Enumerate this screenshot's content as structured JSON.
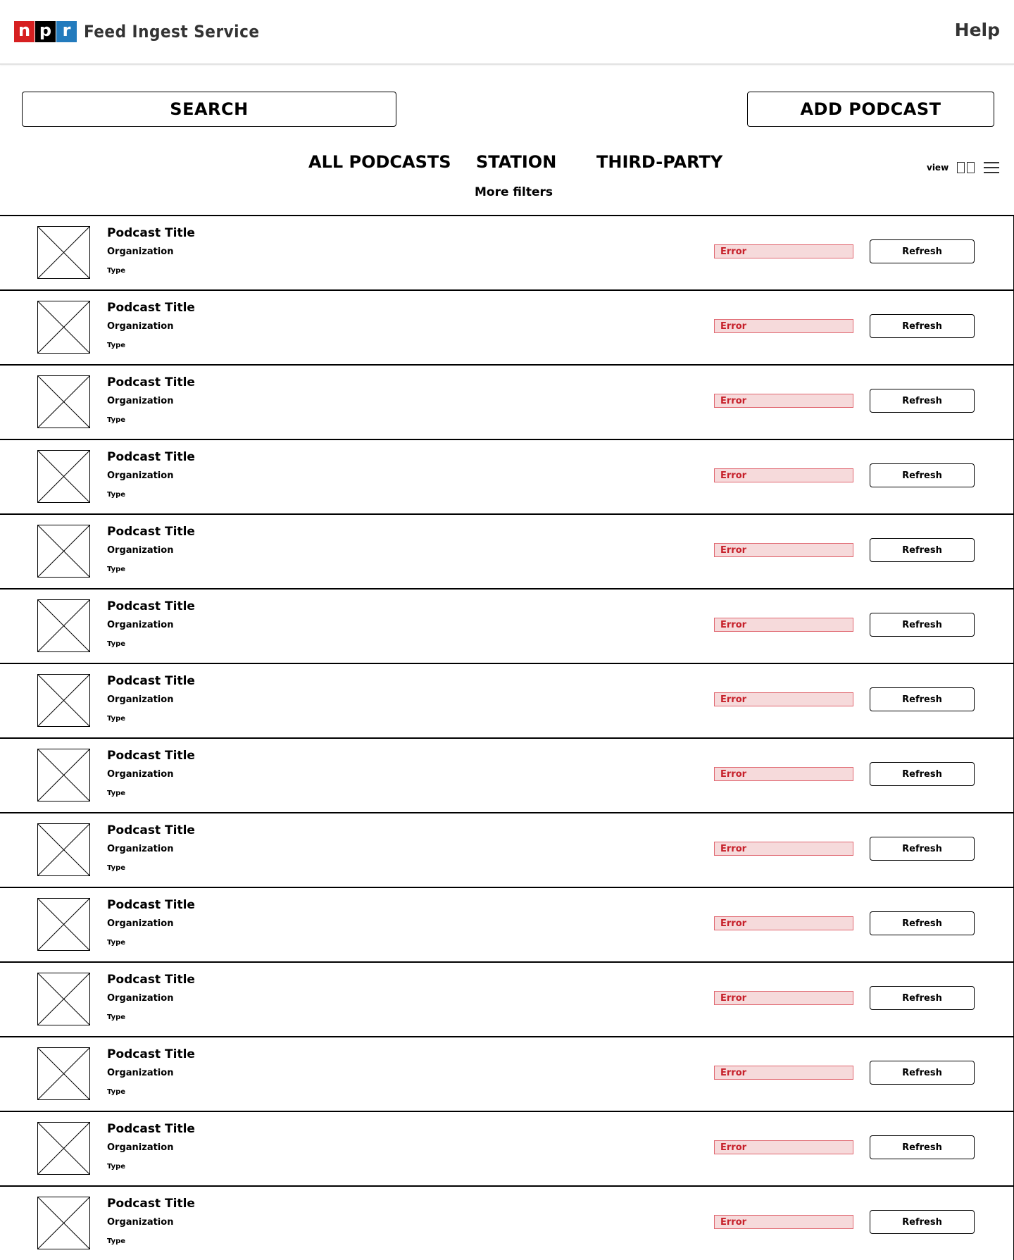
{
  "header": {
    "logo_letters": [
      "n",
      "p",
      "r"
    ],
    "logo_colors": [
      "#d62021",
      "#000000",
      "#237bbd"
    ],
    "title": "Feed Ingest Service",
    "help_label": "Help"
  },
  "actions": {
    "search_label": "Search",
    "add_label": "Add Podcast"
  },
  "tabs": [
    {
      "label": "All Podcasts"
    },
    {
      "label": "Station"
    },
    {
      "label": "Third-Party"
    }
  ],
  "more_filters_label": "More filters",
  "view": {
    "label": "view",
    "grid_icon": "grid-view-icon",
    "list_icon": "list-view-icon"
  },
  "status_colors": {
    "error_bg": "#f6dadb",
    "error_border": "#e06770",
    "error_text": "#c6202a"
  },
  "podcasts": [
    {
      "title": "Podcast Title",
      "organization": "Organization",
      "type": "Type",
      "status": "Error",
      "action": "Refresh"
    },
    {
      "title": "Podcast Title",
      "organization": "Organization",
      "type": "Type",
      "status": "Error",
      "action": "Refresh"
    },
    {
      "title": "Podcast Title",
      "organization": "Organization",
      "type": "Type",
      "status": "Error",
      "action": "Refresh"
    },
    {
      "title": "Podcast Title",
      "organization": "Organization",
      "type": "Type",
      "status": "Error",
      "action": "Refresh"
    },
    {
      "title": "Podcast Title",
      "organization": "Organization",
      "type": "Type",
      "status": "Error",
      "action": "Refresh"
    },
    {
      "title": "Podcast Title",
      "organization": "Organization",
      "type": "Type",
      "status": "Error",
      "action": "Refresh"
    },
    {
      "title": "Podcast Title",
      "organization": "Organization",
      "type": "Type",
      "status": "Error",
      "action": "Refresh"
    },
    {
      "title": "Podcast Title",
      "organization": "Organization",
      "type": "Type",
      "status": "Error",
      "action": "Refresh"
    },
    {
      "title": "Podcast Title",
      "organization": "Organization",
      "type": "Type",
      "status": "Error",
      "action": "Refresh"
    },
    {
      "title": "Podcast Title",
      "organization": "Organization",
      "type": "Type",
      "status": "Error",
      "action": "Refresh"
    },
    {
      "title": "Podcast Title",
      "organization": "Organization",
      "type": "Type",
      "status": "Error",
      "action": "Refresh"
    },
    {
      "title": "Podcast Title",
      "organization": "Organization",
      "type": "Type",
      "status": "Error",
      "action": "Refresh"
    },
    {
      "title": "Podcast Title",
      "organization": "Organization",
      "type": "Type",
      "status": "Error",
      "action": "Refresh"
    },
    {
      "title": "Podcast Title",
      "organization": "Organization",
      "type": "Type",
      "status": "Error",
      "action": "Refresh"
    }
  ]
}
